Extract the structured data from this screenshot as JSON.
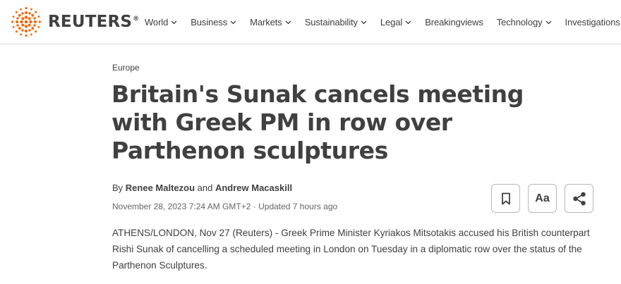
{
  "header": {
    "logo_text": "REUTERS",
    "logo_mark": "®",
    "nav": [
      {
        "label": "World",
        "dropdown": true
      },
      {
        "label": "Business",
        "dropdown": true
      },
      {
        "label": "Markets",
        "dropdown": true
      },
      {
        "label": "Sustainability",
        "dropdown": true
      },
      {
        "label": "Legal",
        "dropdown": true
      },
      {
        "label": "Breakingviews",
        "dropdown": false
      },
      {
        "label": "Technology",
        "dropdown": true
      },
      {
        "label": "Investigations",
        "dropdown": false
      }
    ]
  },
  "article": {
    "category": "Europe",
    "headline": "Britain's Sunak cancels meeting with Greek PM in row over Parthenon sculptures",
    "byline_prefix": "By ",
    "author1": "Renee Maltezou",
    "byline_and": " and ",
    "author2": "Andrew Macaskill",
    "dateline": "November 28, 2023 7:24 AM GMT+2 · Updated 7 hours ago",
    "body": "ATHENS/LONDON, Nov 27 (Reuters) - Greek Prime Minister Kyriakos Mitsotakis accused his British counterpart Rishi Sunak of cancelling a scheduled meeting in London on Tuesday in a diplomatic row over the status of the Parthenon Sculptures."
  },
  "tools": {
    "text_size_label": "Aa",
    "icons": [
      "bookmark-icon",
      "text-size-icon",
      "share-icon"
    ]
  },
  "colors": {
    "logo_orange": "#fa6400",
    "text": "#404040",
    "muted": "#666666",
    "border": "#dcdcdc"
  }
}
